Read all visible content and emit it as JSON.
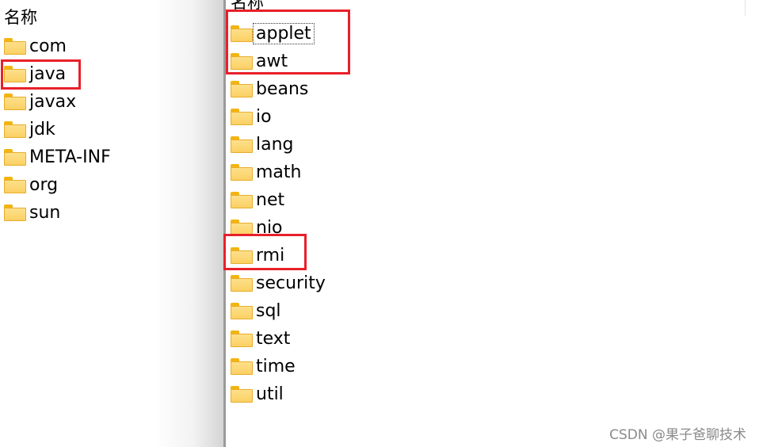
{
  "left_pane": {
    "header": "名称",
    "items": [
      "com",
      "java",
      "javax",
      "jdk",
      "META-INF",
      "org",
      "sun"
    ],
    "highlighted": [
      "java"
    ]
  },
  "right_pane": {
    "header": "名称",
    "items": [
      "applet",
      "awt",
      "beans",
      "io",
      "lang",
      "math",
      "net",
      "nio",
      "rmi",
      "security",
      "sql",
      "text",
      "time",
      "util"
    ],
    "highlighted": [
      "applet",
      "awt",
      "rmi"
    ],
    "focused": "applet"
  },
  "colors": {
    "highlight_box": "#e8202a",
    "folder": "#fbd064"
  },
  "icons": {
    "item": "folder-icon"
  },
  "watermark": "CSDN @果子爸聊技术"
}
